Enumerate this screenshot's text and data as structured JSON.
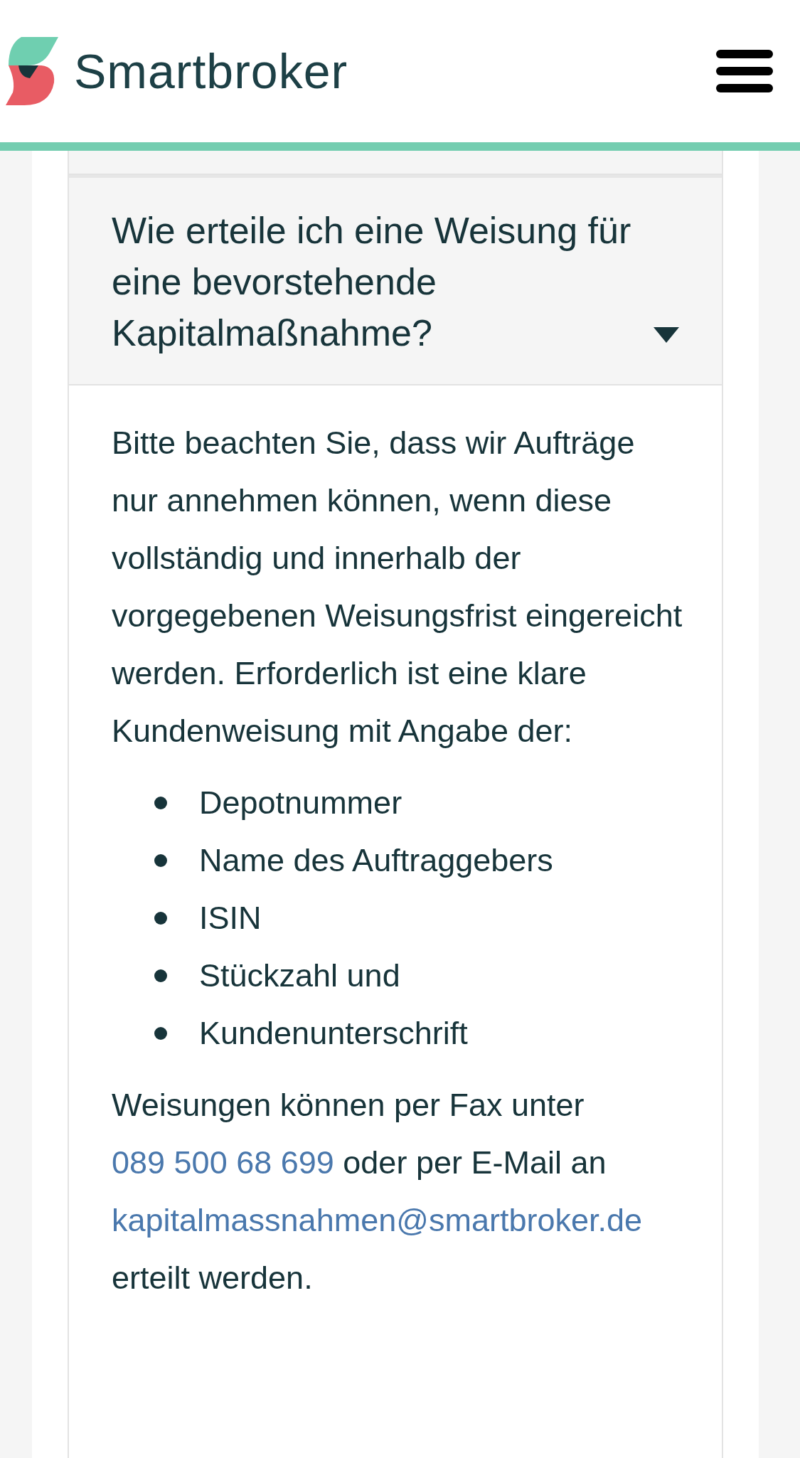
{
  "header": {
    "logo_text": "Smartbroker"
  },
  "faq": [
    {
      "question": "Wie erteile ich eine Weisung für eine bevorstehende Kapitalmaßnahme?",
      "expanded": true,
      "intro": "Bitte beachten Sie, dass wir Aufträge nur annehmen können, wenn diese vollständig und innerhalb der vorgegebenen Weisungsfrist eingereicht werden. Erforderlich ist eine klare Kundenweisung mit Angabe der:",
      "list": [
        "Depotnummer",
        "Name des Auftraggebers",
        "ISIN",
        "Stückzahl und",
        "Kundenunterschrift"
      ],
      "closing": [
        {
          "kind": "text",
          "text": "Weisungen können per Fax unter "
        },
        {
          "kind": "link",
          "text": "089 500 68 699"
        },
        {
          "kind": "text",
          "text": " oder per E-Mail an "
        },
        {
          "kind": "link",
          "text": "kapitalmassnahmen@smartbroker.de"
        },
        {
          "kind": "text",
          "text": " erteilt werden."
        }
      ]
    }
  ]
}
